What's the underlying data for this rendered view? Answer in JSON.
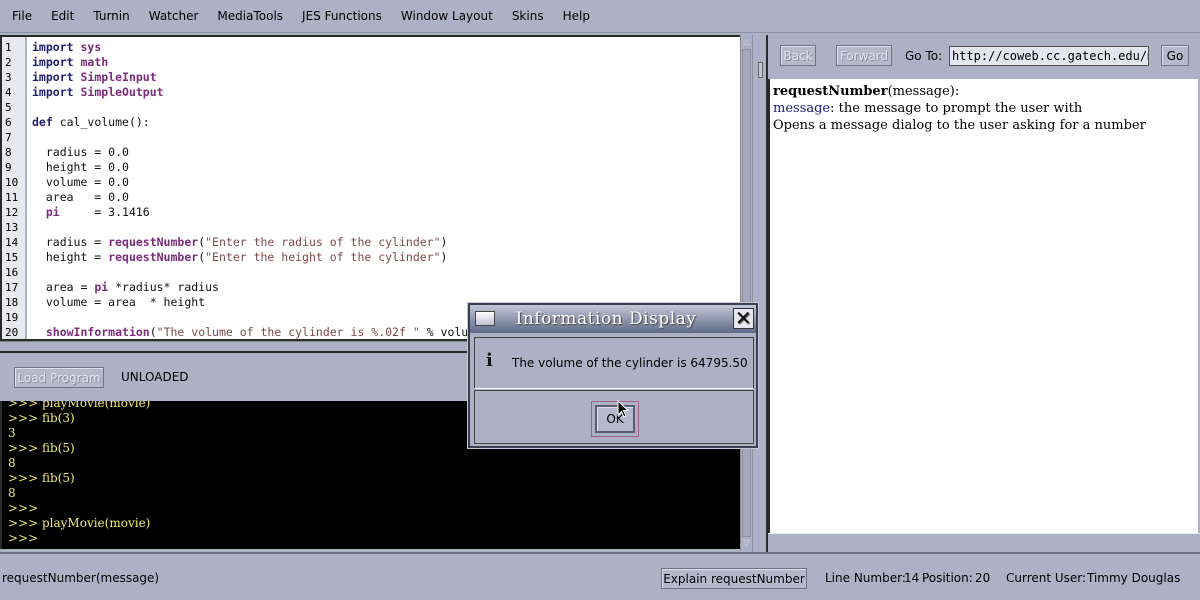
{
  "menubar": {
    "items": [
      "File",
      "Edit",
      "Turnin",
      "Watcher",
      "MediaTools",
      "JES Functions",
      "Window Layout",
      "Skins",
      "Help"
    ]
  },
  "editor": {
    "line_numbers": [
      "1",
      "2",
      "3",
      "4",
      "5",
      "6",
      "7",
      "8",
      "9",
      "10",
      "11",
      "12",
      "13",
      "14",
      "15",
      "16",
      "17",
      "18",
      "19",
      "20"
    ],
    "lines": [
      {
        "kw": "import",
        "rest": " ",
        "mod": "sys"
      },
      {
        "kw": "import",
        "rest": " ",
        "mod": "math"
      },
      {
        "kw": "import",
        "rest": " ",
        "mod": "SimpleInput"
      },
      {
        "kw": "import",
        "rest": " ",
        "mod": "SimpleOutput"
      },
      {},
      {
        "kw": "def",
        "rest": " cal_volume():"
      },
      {},
      {
        "text": "  radius = 0.0"
      },
      {
        "text": "  height = 0.0"
      },
      {
        "text": "  volume = 0.0"
      },
      {
        "text": "  area   = 0.0"
      },
      {
        "pre": "  ",
        "mod": "pi",
        "text": "     = 3.1416"
      },
      {},
      {
        "pre": "  radius = ",
        "fn": "requestNumber",
        "p1": "(",
        "str": "\"Enter the radius of the cylinder\"",
        "p2": ")"
      },
      {
        "pre": "  height = ",
        "fn": "requestNumber",
        "p1": "(",
        "str": "\"Enter the height of the cylinder\"",
        "p2": ")"
      },
      {},
      {
        "pre": "  area = ",
        "mod": "pi",
        "text": " *radius* radius"
      },
      {
        "text": "  volume = area  * height"
      },
      {},
      {
        "pre": "  ",
        "fn": "showInformation",
        "p1": "(",
        "str": "\"The volume of the cylinder is %.02f \"",
        "p2": " % volume)"
      }
    ]
  },
  "load_bar": {
    "load_button": "Load Program",
    "status": "UNLOADED"
  },
  "console": {
    "lines": [
      ">>> playMovie(movie)",
      ">>> fib(3)",
      "3",
      ">>> fib(5)",
      "8",
      ">>> fib(5)",
      "8",
      ">>>",
      ">>> playMovie(movie)",
      ">>>"
    ]
  },
  "help": {
    "back": "Back",
    "forward": "Forward",
    "goto_label": "Go To:",
    "url": "http://coweb.cc.gatech.edu/mediaComp-plan/",
    "go": "Go",
    "sig_name": "requestNumber",
    "sig_args": "(message):",
    "param_name": "message",
    "param_desc": ": the message to prompt the user with",
    "description": "Opens a message dialog to the user asking for a number"
  },
  "status": {
    "hint": "requestNumber(message)",
    "explain_button": "Explain requestNumber",
    "line_label": "Line Number:",
    "line_value": "14",
    "pos_label": "Position:",
    "pos_value": "20",
    "user_label": "Current User:",
    "user_value": "Timmy Douglas"
  },
  "dialog": {
    "title": "Information Display",
    "message": "The volume of the cylinder is 64795.50",
    "ok": "OK",
    "icon": "info-icon"
  }
}
